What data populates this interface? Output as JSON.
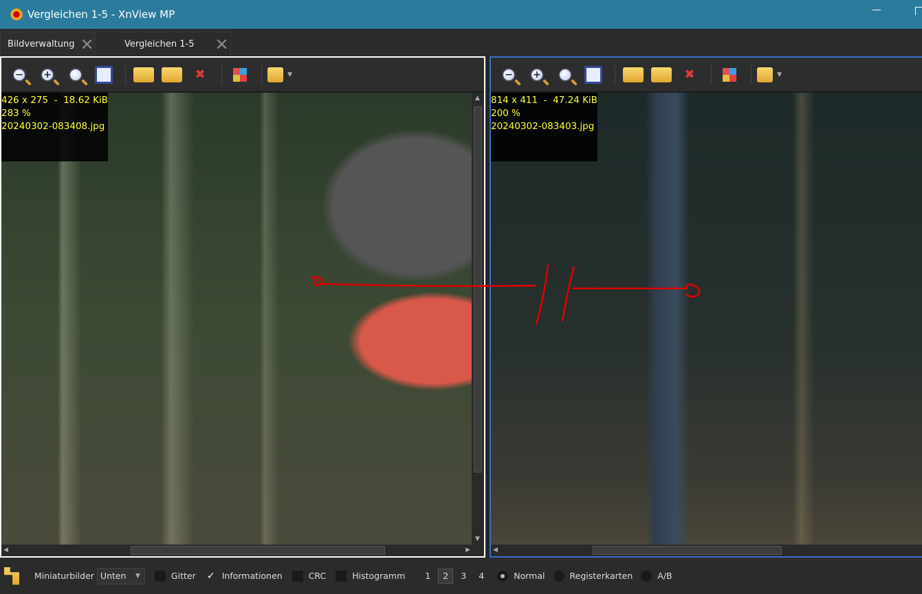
{
  "window": {
    "title": "Vergleichen 1-5 - XnView MP"
  },
  "tabs": [
    {
      "label": "Bildverwaltung"
    },
    {
      "label": "Vergleichen 1-5",
      "active": true
    }
  ],
  "toolbar_icons": [
    "zoom-out-icon",
    "zoom-in-icon",
    "zoom-reset-icon",
    "fit-to-window-icon",
    "copy-to-folder-icon",
    "move-to-folder-icon",
    "delete-icon",
    "compare-layout-icon",
    "open-folder-icon"
  ],
  "panes": [
    {
      "dimensions": "426 x 275  -  18.62 KiB",
      "zoom": "283 %",
      "filename": "20240302-083408.jpg",
      "selected": false
    },
    {
      "dimensions": "814 x 411  -  47.24 KiB",
      "zoom": "200 %",
      "filename": "20240302-083403.jpg",
      "selected": true
    }
  ],
  "bottom": {
    "thumbnails_label": "Miniaturbilder",
    "thumbnails_value": "Unten",
    "grid_label": "Gitter",
    "grid_checked": false,
    "info_label": "Informationen",
    "info_checked": true,
    "check_mark": "✓",
    "crc_label": "CRC",
    "crc_checked": false,
    "histogram_label": "Histogramm",
    "histogram_checked": false,
    "counts": [
      "1",
      "2",
      "3",
      "4"
    ],
    "active_count": "2",
    "modes": [
      "Normal",
      "Registerkarten",
      "A/B"
    ],
    "active_mode": "Normal"
  },
  "colors": {
    "titlebar": "#2b7c9c",
    "selected_border": "#3a6fc6",
    "info_text": "#ffff33",
    "annotation": "#e00000"
  }
}
